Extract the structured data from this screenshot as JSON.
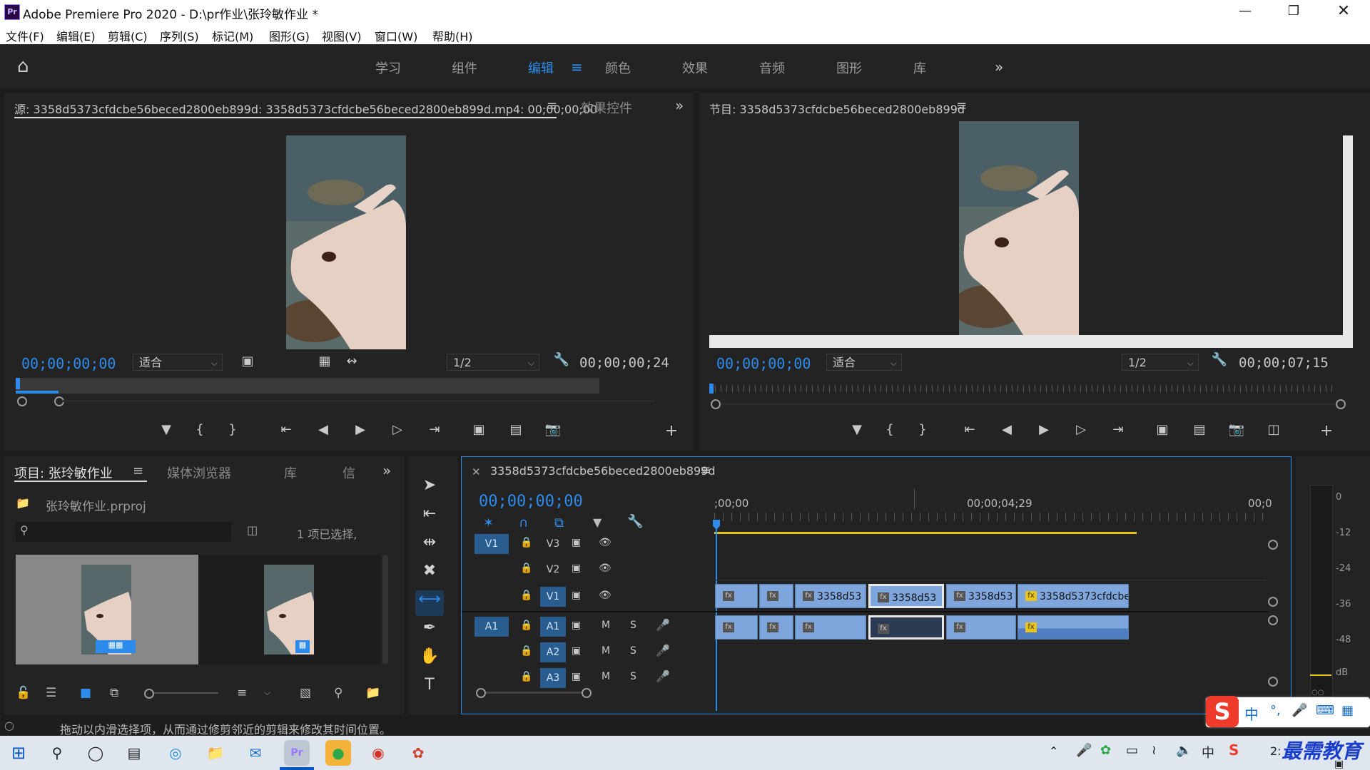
{
  "app": {
    "title": "Adobe Premiere Pro 2020 - D:\\pr作业\\张玲敏作业 *",
    "icon_text": "Pr"
  },
  "menu": [
    "文件(F)",
    "编辑(E)",
    "剪辑(C)",
    "序列(S)",
    "标记(M)",
    "图形(G)",
    "视图(V)",
    "窗口(W)",
    "帮助(H)"
  ],
  "workspaces": [
    "学习",
    "组件",
    "编辑",
    "颜色",
    "效果",
    "音频",
    "图形",
    "库"
  ],
  "source": {
    "tab_label": "源: 3358d5373cfdcbe56beced2800eb899d: 3358d5373cfdcbe56beced2800eb899d.mp4: 00;00;00;00",
    "effect_tab": "效果控件",
    "timecode": "00;00;00;00",
    "fit": "适合",
    "resolution": "1/2",
    "duration": "00;00;00;24"
  },
  "program": {
    "tab_label": "节目: 3358d5373cfdcbe56beced2800eb899d",
    "timecode": "00;00;00;00",
    "fit": "适合",
    "resolution": "1/2",
    "duration": "00;00;07;15"
  },
  "project": {
    "tabs": [
      "项目: 张玲敏作业",
      "媒体浏览器",
      "库",
      "信"
    ],
    "file": "张玲敏作业.prproj",
    "selection": "1 项已选择,",
    "search_placeholder": ""
  },
  "timeline": {
    "sequence_name": "3358d5373cfdcbe56beced2800eb899d",
    "timecode": "00;00;00;00",
    "ruler": [
      ";00;00",
      "00;00;04;29",
      "00;0"
    ],
    "video_tracks": [
      {
        "src": "V1",
        "name": "V3"
      },
      {
        "src": "",
        "name": "V2"
      },
      {
        "src": "",
        "name": "V1"
      }
    ],
    "audio_tracks": [
      {
        "src": "A1",
        "name": "A1",
        "m": "M",
        "s": "S"
      },
      {
        "src": "",
        "name": "A2",
        "m": "M",
        "s": "S"
      },
      {
        "src": "",
        "name": "A3",
        "m": "M",
        "s": "S"
      }
    ],
    "clips": [
      "",
      "",
      "3358d53",
      "3358d53",
      "3358d53",
      "3358d5373cfdcbe"
    ],
    "fx_label": "fx"
  },
  "meter": {
    "ticks": [
      "0",
      "-12",
      "-24",
      "-36",
      "-48",
      "dB"
    ]
  },
  "status": {
    "text": "拖动以内滑选择项，从而通过修剪邻近的剪辑来修改其时间位置。"
  },
  "ime": {
    "items": [
      "中",
      "°,",
      "🎤",
      "⌨",
      "▦"
    ],
    "logo": "S"
  },
  "taskbar": {
    "clock": "2:",
    "watermark": "最需教育",
    "lang": "中"
  },
  "colors": {
    "accent_blue": "#2d8ceb",
    "clip_blue": "#7ea6dd",
    "panel_bg": "#232323",
    "work_area": "#e9c31a"
  }
}
